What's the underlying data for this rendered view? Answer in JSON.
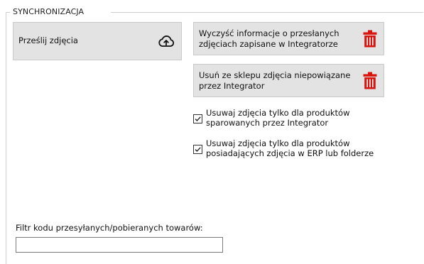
{
  "group": {
    "title": "SYNCHRONIZACJA"
  },
  "buttons": {
    "send_photos": {
      "label": "Prześlij zdjęcia",
      "icon": "cloud-upload-icon"
    },
    "clear_info": {
      "label": "Wyczyść informacje o przesłanych zdjęciach zapisane w Integratorze",
      "icon": "trash-icon",
      "icon_color": "#d9140f"
    },
    "remove_unlinked": {
      "label": "Usuń ze sklepu zdjęcia niepowiązane przez Integrator",
      "icon": "trash-icon",
      "icon_color": "#d9140f"
    }
  },
  "options": [
    {
      "label": "Usuwaj zdjęcia tylko dla produktów sparowanych przez Integrator",
      "checked": true
    },
    {
      "label": "Usuwaj zdjęcia tylko dla produktów posiadających zdjęcia w ERP lub folderze",
      "checked": true
    }
  ],
  "filter": {
    "label": "Filtr kodu przesyłanych/pobieranych towarów:",
    "value": ""
  }
}
